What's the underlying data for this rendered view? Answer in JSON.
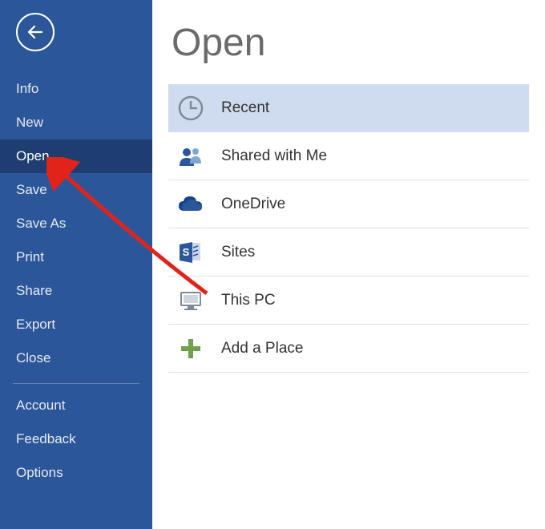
{
  "colors": {
    "sidebar_bg": "#2b579a",
    "sidebar_selected": "#1e3d70",
    "accent_blue": "#2b579a",
    "selection_bg": "#cfdcef",
    "arrow": "#e2231a",
    "title_gray": "#6b6b6b"
  },
  "sidebar": {
    "items": {
      "0": {
        "label": "Info"
      },
      "1": {
        "label": "New"
      },
      "2": {
        "label": "Open"
      },
      "3": {
        "label": "Save"
      },
      "4": {
        "label": "Save As"
      },
      "5": {
        "label": "Print"
      },
      "6": {
        "label": "Share"
      },
      "7": {
        "label": "Export"
      },
      "8": {
        "label": "Close"
      }
    },
    "footer": {
      "0": {
        "label": "Account"
      },
      "1": {
        "label": "Feedback"
      },
      "2": {
        "label": "Options"
      }
    },
    "selected": "Open"
  },
  "page": {
    "title": "Open"
  },
  "locations": {
    "items": {
      "0": {
        "label": "Recent",
        "icon": "clock-icon"
      },
      "1": {
        "label": "Shared with Me",
        "icon": "people-icon"
      },
      "2": {
        "label": "OneDrive",
        "icon": "cloud-icon"
      },
      "3": {
        "label": "Sites",
        "icon": "sharepoint-icon"
      },
      "4": {
        "label": "This PC",
        "icon": "computer-icon"
      },
      "5": {
        "label": "Add a Place",
        "icon": "plus-icon"
      }
    },
    "selected": "Recent"
  },
  "annotation": {
    "type": "arrow",
    "points_to": "Open"
  }
}
